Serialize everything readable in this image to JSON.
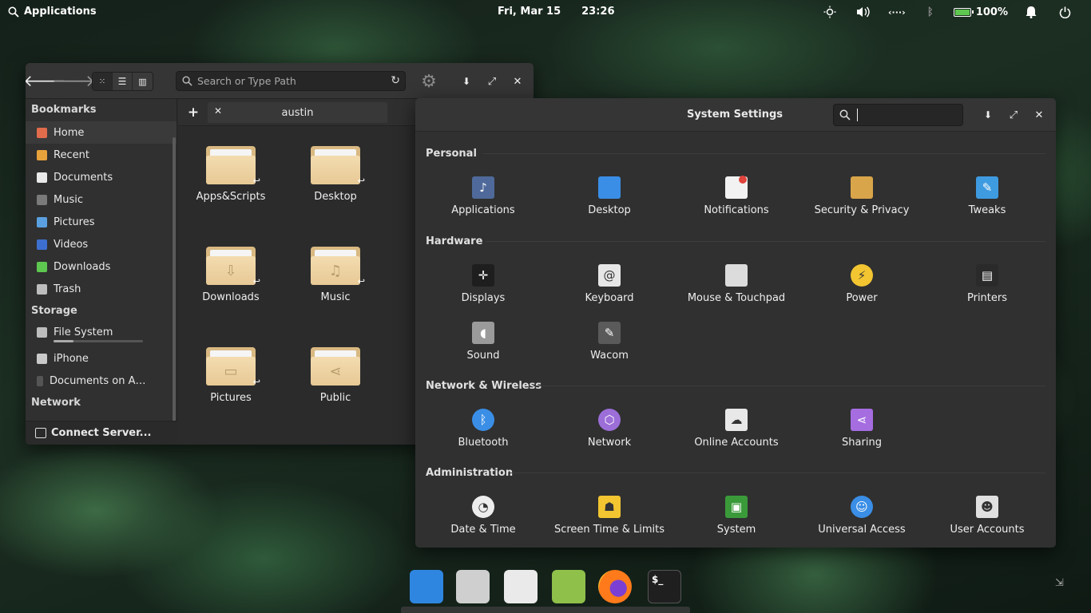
{
  "panel": {
    "applications": "Applications",
    "date": "Fri, Mar 15",
    "time": "23:26",
    "battery": "100%",
    "icons": [
      "brightness-icon",
      "volume-icon",
      "network-icon",
      "bluetooth-icon",
      "battery-icon",
      "notifications-icon",
      "power-icon"
    ]
  },
  "files": {
    "search_placeholder": "Search or Type Path",
    "tab_label": "austin",
    "sidebar": {
      "bookmarks_title": "Bookmarks",
      "bookmarks": [
        {
          "label": "Home",
          "color": "#e06c4c"
        },
        {
          "label": "Recent",
          "color": "#e8a23c"
        },
        {
          "label": "Documents",
          "color": "#eaeaea"
        },
        {
          "label": "Music",
          "color": "#7a7a7a"
        },
        {
          "label": "Pictures",
          "color": "#5aa0e0"
        },
        {
          "label": "Videos",
          "color": "#3c6fd0"
        },
        {
          "label": "Downloads",
          "color": "#5ec750"
        },
        {
          "label": "Trash",
          "color": "#bdbdbd"
        }
      ],
      "storage_title": "Storage",
      "storage": [
        {
          "label": "File System"
        },
        {
          "label": "iPhone"
        },
        {
          "label": "Documents on A…"
        }
      ],
      "network_title": "Network",
      "connect": "Connect Server..."
    },
    "items": [
      {
        "label": "Apps&Scripts",
        "emblem": ""
      },
      {
        "label": "Desktop",
        "emblem": ""
      },
      {
        "label": "Downloads",
        "emblem": "⇩"
      },
      {
        "label": "Music",
        "emblem": "♫"
      },
      {
        "label": "Pictures",
        "emblem": "▭"
      },
      {
        "label": "Public",
        "emblem": "⋖"
      }
    ]
  },
  "settings": {
    "title": "System Settings",
    "sections": {
      "personal": "Personal",
      "hardware": "Hardware",
      "network": "Network & Wireless",
      "admin": "Administration"
    },
    "personal": [
      {
        "label": "Applications",
        "color": "#4f6a9a",
        "icon": "♪"
      },
      {
        "label": "Desktop",
        "color": "#3a8ee6",
        "icon": ""
      },
      {
        "label": "Notifications",
        "color": "#f2f2f2",
        "icon": ""
      },
      {
        "label": "Security & Privacy",
        "color": "#d9a54a",
        "icon": ""
      },
      {
        "label": "Tweaks",
        "color": "#3f9be0",
        "icon": "✎"
      }
    ],
    "hardware": [
      {
        "label": "Displays",
        "color": "#1e1e1e",
        "icon": "✛"
      },
      {
        "label": "Keyboard",
        "color": "#e6e6e6",
        "icon": "@"
      },
      {
        "label": "Mouse & Touchpad",
        "color": "#dcdcdc",
        "icon": ""
      },
      {
        "label": "Power",
        "color": "#f2c531",
        "icon": "⚡"
      },
      {
        "label": "Printers",
        "color": "#2a2a2a",
        "icon": "▤"
      },
      {
        "label": "Sound",
        "color": "#9a9a9a",
        "icon": "◖"
      },
      {
        "label": "Wacom",
        "color": "#5a5a5a",
        "icon": "✎"
      }
    ],
    "network": [
      {
        "label": "Bluetooth",
        "color": "#3a8ee6",
        "icon": "ᛒ"
      },
      {
        "label": "Network",
        "color": "#9c6ed8",
        "icon": "⬡"
      },
      {
        "label": "Online Accounts",
        "color": "#e8e8e8",
        "icon": "☁"
      },
      {
        "label": "Sharing",
        "color": "#a56de0",
        "icon": "⋖"
      }
    ],
    "admin": [
      {
        "label": "Date & Time",
        "color": "#ededed",
        "icon": "◔"
      },
      {
        "label": "Screen Time & Limits",
        "color": "#f2c531",
        "icon": "☗"
      },
      {
        "label": "System",
        "color": "#3a9a3a",
        "icon": "▣"
      },
      {
        "label": "Universal Access",
        "color": "#3a8ee6",
        "icon": "☺"
      },
      {
        "label": "User Accounts",
        "color": "#e0e0e0",
        "icon": "☻"
      }
    ]
  },
  "dock": [
    {
      "name": "multitasking-view",
      "color": "#2f86e0"
    },
    {
      "name": "files",
      "color": "#cfcfcf"
    },
    {
      "name": "system-settings",
      "color": "#eaeaea"
    },
    {
      "name": "appcenter",
      "color": "#8fc04a"
    },
    {
      "name": "firefox",
      "color": "#ff7a1a"
    },
    {
      "name": "terminal",
      "color": "#1f1f1f",
      "text": "$_"
    }
  ]
}
